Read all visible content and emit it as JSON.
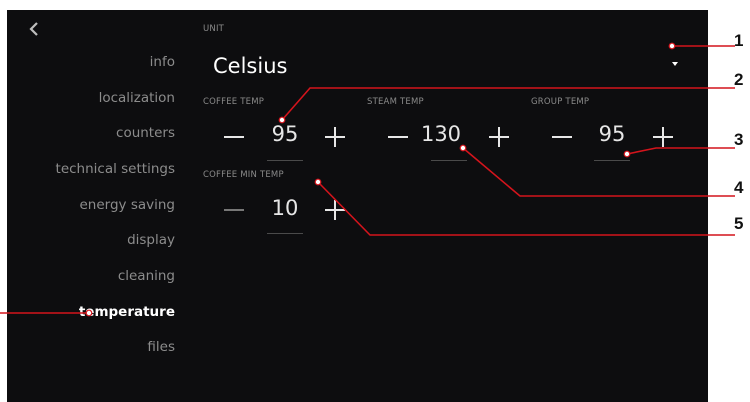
{
  "sidebar": {
    "items": [
      {
        "label": "info"
      },
      {
        "label": "localization"
      },
      {
        "label": "counters"
      },
      {
        "label": "technical settings"
      },
      {
        "label": "energy saving"
      },
      {
        "label": "display"
      },
      {
        "label": "cleaning"
      },
      {
        "label": "temperature",
        "active": true
      },
      {
        "label": "files"
      }
    ]
  },
  "unit": {
    "label": "UNIT",
    "value": "Celsius"
  },
  "temps": {
    "coffee": {
      "label": "COFFEE TEMP",
      "value": "95"
    },
    "steam": {
      "label": "STEAM TEMP",
      "value": "130"
    },
    "group": {
      "label": "GROUP TEMP",
      "value": "95"
    },
    "coffee_min": {
      "label": "COFFEE MIN TEMP",
      "value": "10"
    }
  },
  "callouts": [
    "1",
    "2",
    "3",
    "4",
    "5"
  ],
  "colors": {
    "background": "#0d0d0f",
    "callout_line": "#d4141c",
    "active_text": "#ffffff",
    "inactive_text": "#8c8c8c"
  },
  "icons": {
    "back": "chevron-left-icon",
    "dropdown": "caret-down-icon"
  }
}
